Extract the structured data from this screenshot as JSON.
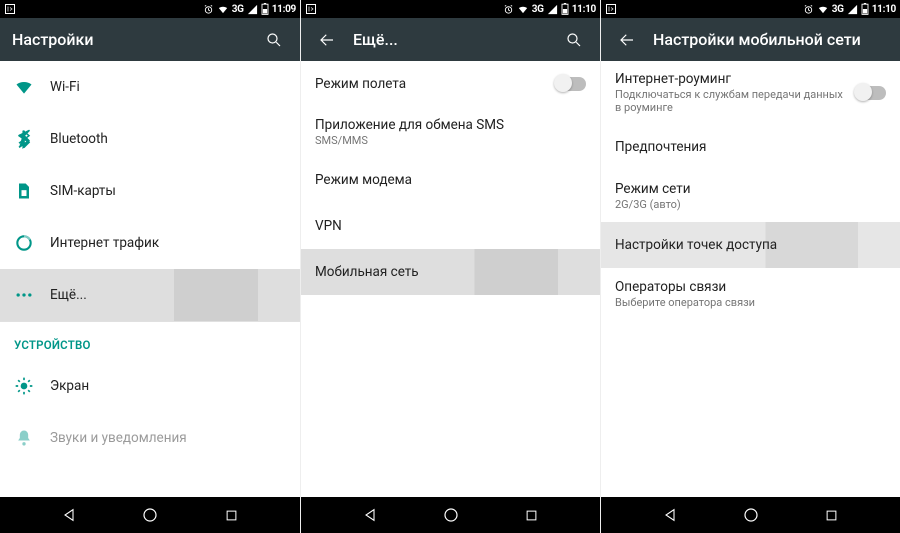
{
  "status": {
    "network_label": "3G",
    "time_a": "11:09",
    "time_b": "11:10",
    "time_c": "11:10"
  },
  "pane1": {
    "title": "Настройки",
    "items": {
      "wifi": "Wi-Fi",
      "bluetooth": "Bluetooth",
      "sim": "SIM-карты",
      "traffic": "Интернет трафик",
      "more": "Ещё..."
    },
    "section_device": "УСТРОЙСТВО",
    "display": "Экран",
    "sound": "Звуки и уведомления"
  },
  "pane2": {
    "title": "Ещё...",
    "airplane": "Режим полета",
    "sms_app": "Приложение для обмена SMS",
    "sms_app_sub": "SMS/MMS",
    "tether": "Режим модема",
    "vpn": "VPN",
    "mobile": "Мобильная сеть"
  },
  "pane3": {
    "title": "Настройки мобильной сети",
    "roaming": "Интернет-роуминг",
    "roaming_sub": "Подключаться к службам передачи данных в роуминге",
    "prefs": "Предпочтения",
    "mode": "Режим сети",
    "mode_sub": "2G/3G (авто)",
    "apn": "Настройки точек доступа",
    "operators": "Операторы связи",
    "operators_sub": "Выберите оператора связи"
  }
}
